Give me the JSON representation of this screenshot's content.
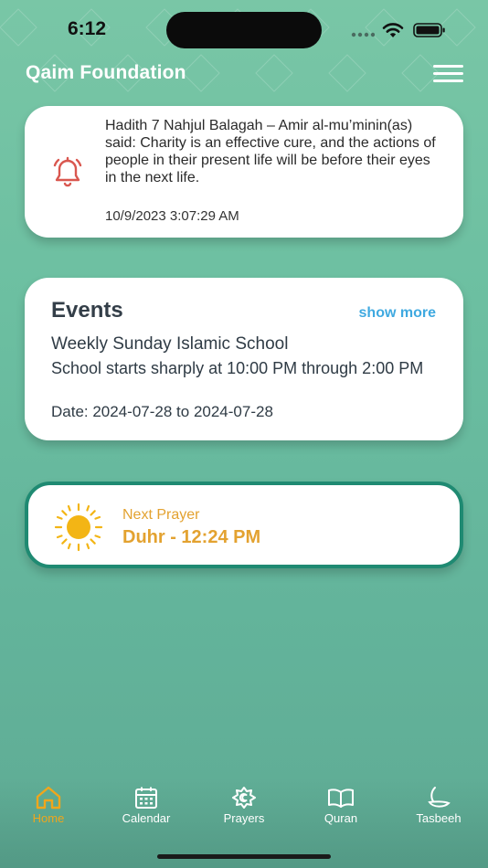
{
  "status_bar": {
    "time": "6:12"
  },
  "header": {
    "title": "Qaim Foundation"
  },
  "hadith": {
    "text": "Hadith 7 Nahjul Balagah – Amir al-mu’minin(as) said: Charity is an effective cure, and the actions of people in their present life will be before their eyes in the next life.",
    "date": "10/9/2023 3:07:29 AM",
    "icon": "bell-icon"
  },
  "events": {
    "title": "Events",
    "show_more": "show more",
    "name": "Weekly Sunday Islamic School",
    "description": "School starts sharply at 10:00 PM through 2:00 PM",
    "date": "Date: 2024-07-28 to 2024-07-28"
  },
  "prayer": {
    "label": "Next Prayer",
    "time": "Duhr - 12:24 PM",
    "icon": "sun-icon"
  },
  "tabs": [
    {
      "label": "Home",
      "icon": "home-icon",
      "active": true
    },
    {
      "label": "Calendar",
      "icon": "calendar-icon",
      "active": false
    },
    {
      "label": "Prayers",
      "icon": "mosque-icon",
      "active": false
    },
    {
      "label": "Quran",
      "icon": "book-icon",
      "active": false
    },
    {
      "label": "Tasbeeh",
      "icon": "tasbeeh-icon",
      "active": false
    }
  ],
  "colors": {
    "accent": "#e3a230",
    "link": "#3fa9e0",
    "bell": "#d9574f",
    "prayer_border": "#1f8a72",
    "background": "#6cbfa1"
  }
}
